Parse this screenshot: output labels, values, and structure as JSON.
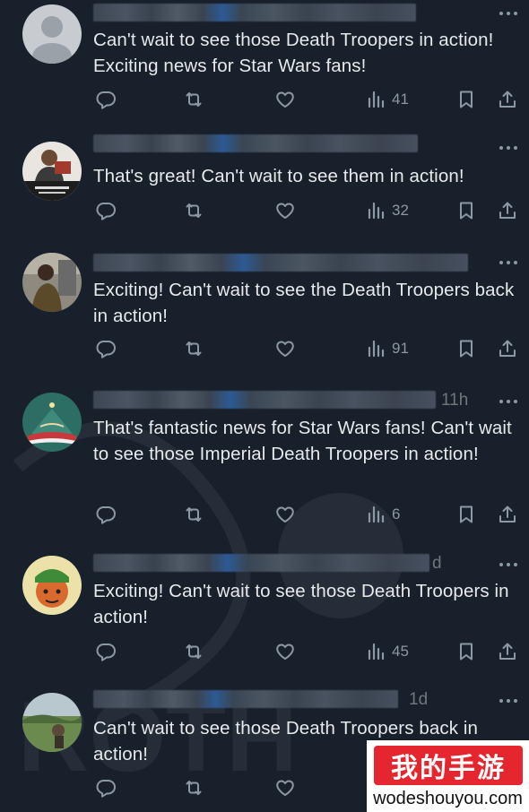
{
  "tweets": [
    {
      "text": "Can't wait to see those Death Troopers in action! Exciting news for Star Wars fans!",
      "time": "",
      "views": "41",
      "avatar": "default-avatar"
    },
    {
      "text": "That's great! Can't wait to see them in action!",
      "time": "",
      "views": "32",
      "avatar": "photo-avatar-person"
    },
    {
      "text": "Exciting! Can't wait to see the Death Troopers back in action!",
      "time": "",
      "views": "91",
      "avatar": "photo-avatar-person"
    },
    {
      "text": "That's fantastic news for Star Wars fans! Can't wait to see those Imperial Death Troopers in action!",
      "time": "11h",
      "views": "6",
      "avatar": "logo-avatar"
    },
    {
      "text": "Exciting! Can't wait to see those Death Troopers in action!",
      "time": "d",
      "views": "45",
      "avatar": "cartoon-avatar"
    },
    {
      "text": "Can't wait to see those Death Troopers back in action!",
      "time": "1d",
      "views": "",
      "avatar": "landscape-avatar"
    }
  ],
  "icons": {
    "reply": "reply-icon",
    "retweet": "retweet-icon",
    "like": "heart-icon",
    "views": "views-icon",
    "bookmark": "bookmark-icon",
    "share": "share-icon",
    "more": "more-icon"
  },
  "watermark": {
    "title": "我的手游",
    "url": "wodeshouyou.com"
  },
  "colors": {
    "background": "#17202b",
    "text": "#e7e9ea",
    "muted": "#8b98a5",
    "watermark_red": "#e6262e"
  }
}
